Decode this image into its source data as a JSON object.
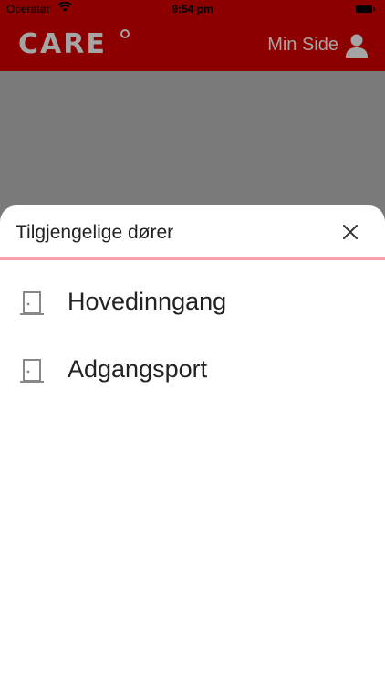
{
  "status_bar": {
    "carrier": "Operatør",
    "time": "9:54 pm",
    "wifi_icon": "wifi-icon",
    "battery_icon": "battery-icon"
  },
  "nav": {
    "logo_text": "CARE",
    "profile_label": "Min Side",
    "profile_icon": "user-icon",
    "brand_color": "#8c0000",
    "text_color": "#a5a5a5"
  },
  "sheet": {
    "title": "Tilgjengelige dører",
    "close_icon": "close-icon",
    "accent_color": "#f3a3a6",
    "doors": [
      {
        "label": "Hovedinngang",
        "icon": "door-icon"
      },
      {
        "label": "Adgangsport",
        "icon": "door-icon"
      }
    ]
  }
}
